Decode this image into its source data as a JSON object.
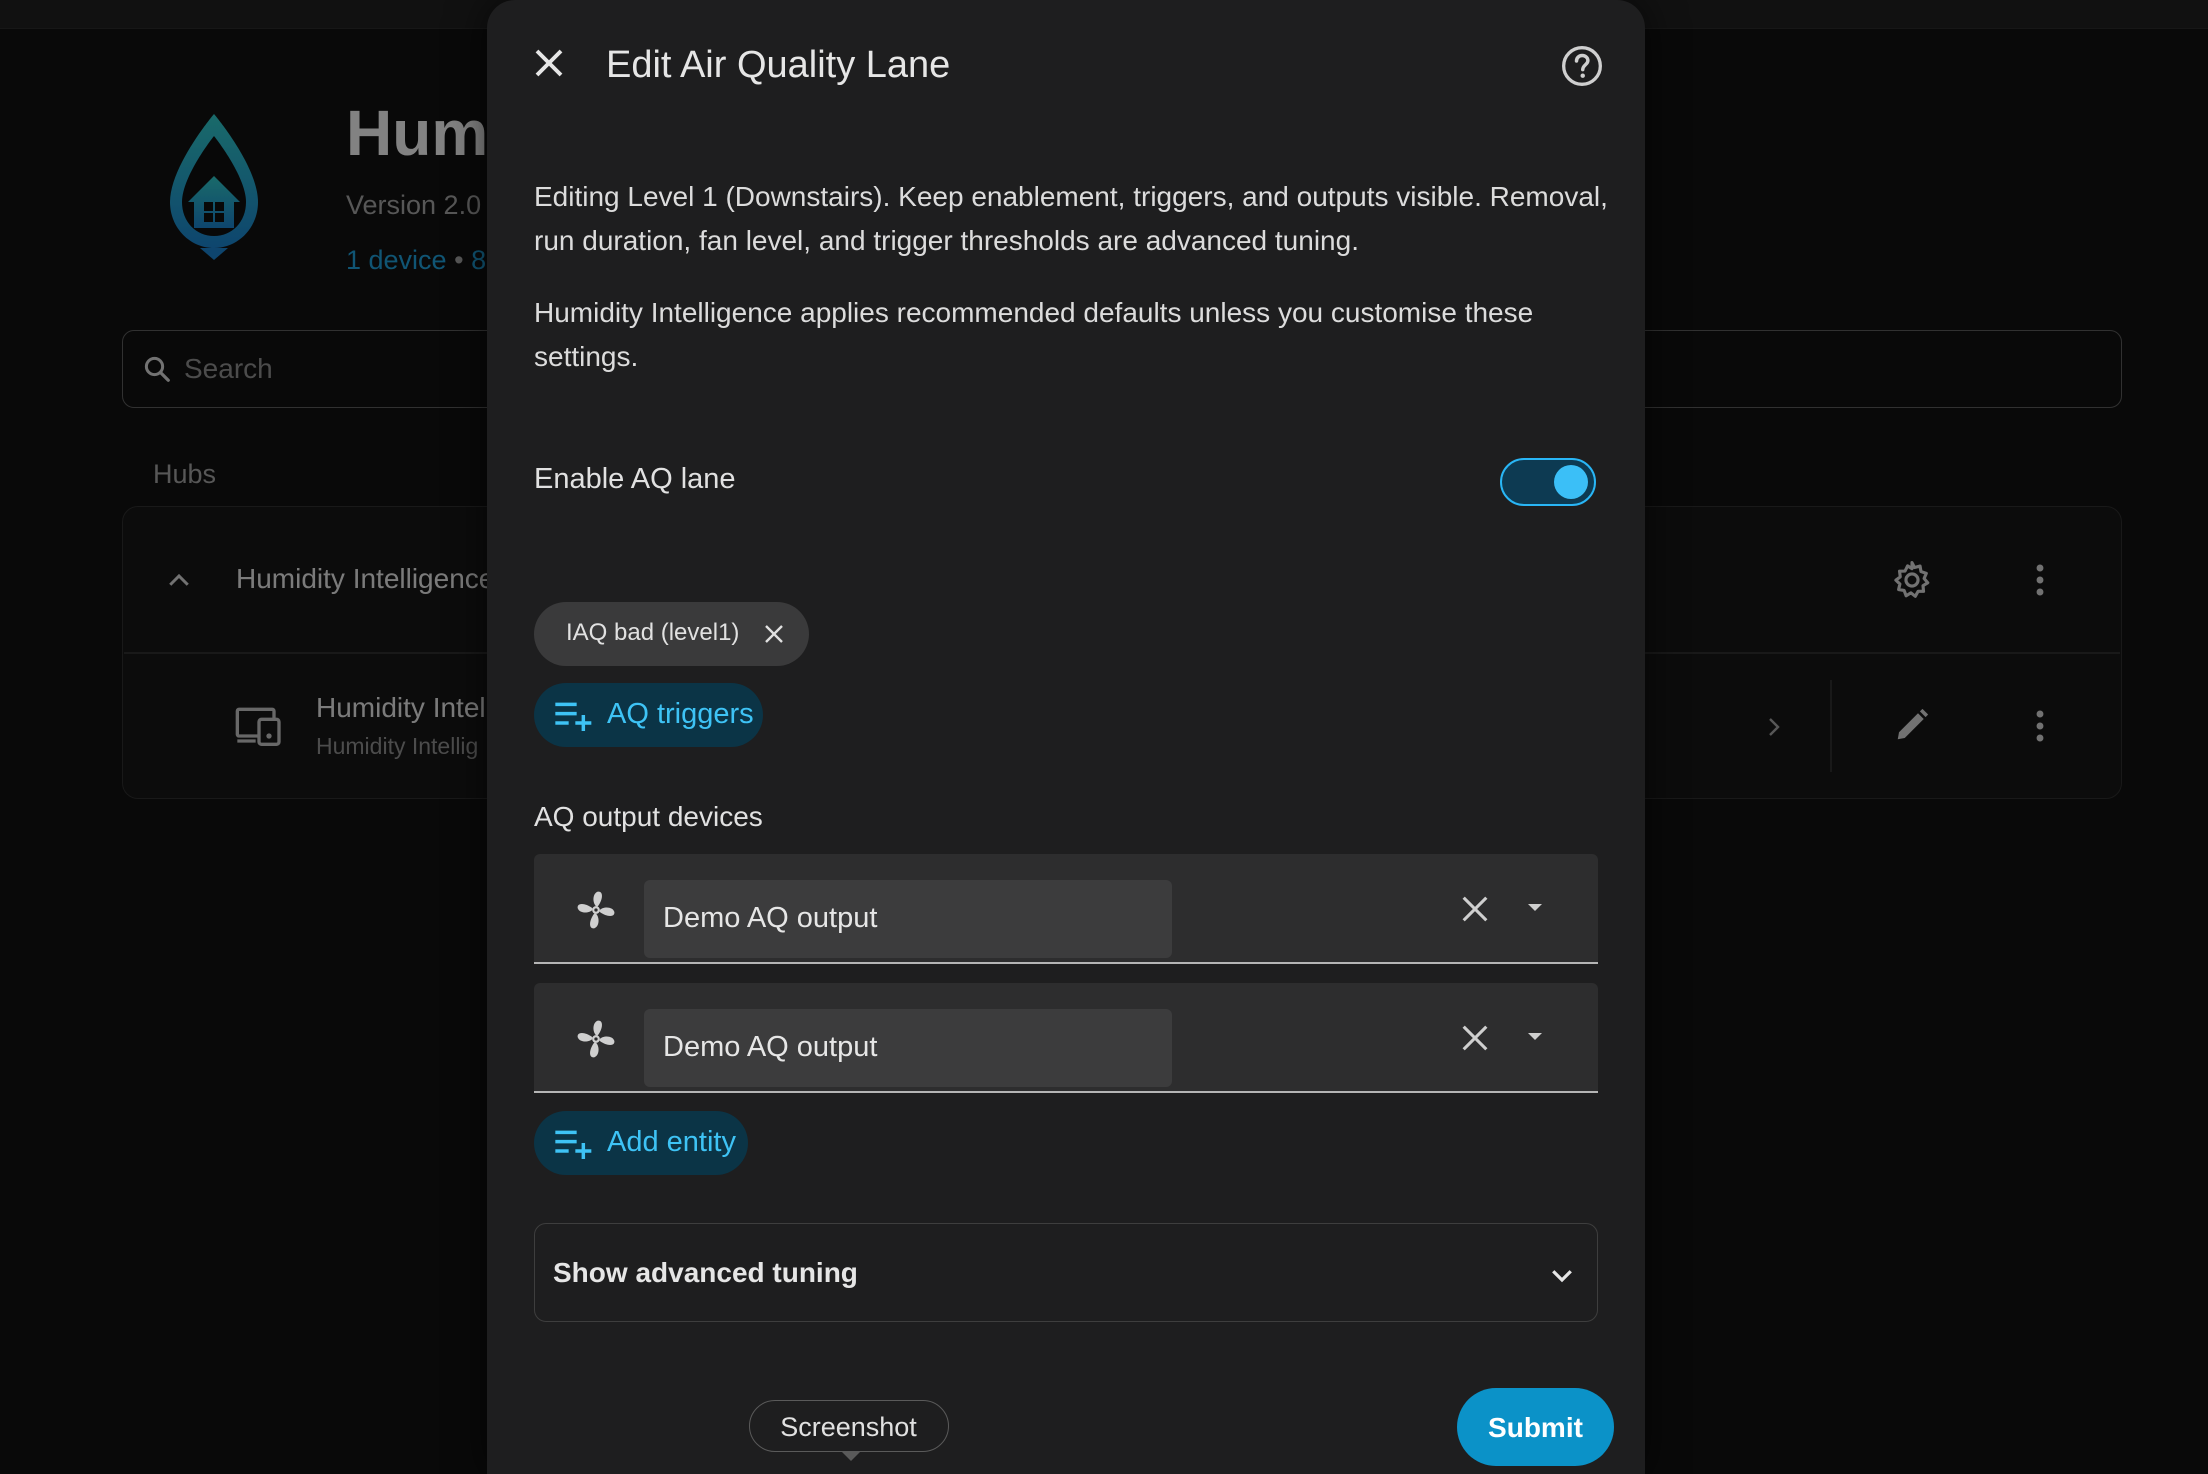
{
  "background": {
    "title": "Hum",
    "version": "Version 2.0",
    "links": {
      "devices": "1 device",
      "separator": "•",
      "more": "8"
    },
    "search": {
      "placeholder": "Search"
    },
    "section_label": "Hubs",
    "hub": {
      "name": "Humidity Intelligence"
    },
    "device": {
      "name": "Humidity Intel",
      "subtitle": "Humidity Intellig"
    },
    "icons": [
      "app-logo-icon",
      "search-icon",
      "chevron-up-icon",
      "gear-icon",
      "more-vert-icon",
      "devices-icon",
      "chevron-right-icon",
      "pencil-icon"
    ],
    "colors": {
      "link": "#1e9bd4",
      "logo_top": "#2fc2c2",
      "logo_bottom": "#1a7fc8"
    }
  },
  "dialog": {
    "title": "Edit Air Quality Lane",
    "description": "Editing Level 1 (Downstairs). Keep enablement, triggers, and outputs visible. Removal, run duration, fan level, and trigger thresholds are advanced tuning.",
    "defaults_note": "Humidity Intelligence applies recommended defaults unless you customise these settings.",
    "enable_toggle": {
      "label": "Enable AQ lane",
      "checked": true
    },
    "trigger_chips": [
      {
        "label": "IAQ bad (level1)"
      }
    ],
    "triggers_button": "AQ triggers",
    "outputs": {
      "label": "AQ output devices",
      "items": [
        {
          "value": "Demo AQ output"
        },
        {
          "value": "Demo AQ output"
        }
      ]
    },
    "add_entity_button": "Add entity",
    "advanced": {
      "label": "Show advanced tuning",
      "expanded": false
    },
    "submit_button": "Submit",
    "tooltip": "Screenshot",
    "icons": [
      "close-icon",
      "help-icon",
      "chip-close-icon",
      "playlist-plus-icon",
      "fan-icon",
      "clear-icon",
      "dropdown-icon",
      "chevron-down-icon"
    ],
    "colors": {
      "accent": "#29b6f6",
      "tonal_bg": "#0b3446",
      "submit_bg": "#0b92c8"
    }
  }
}
